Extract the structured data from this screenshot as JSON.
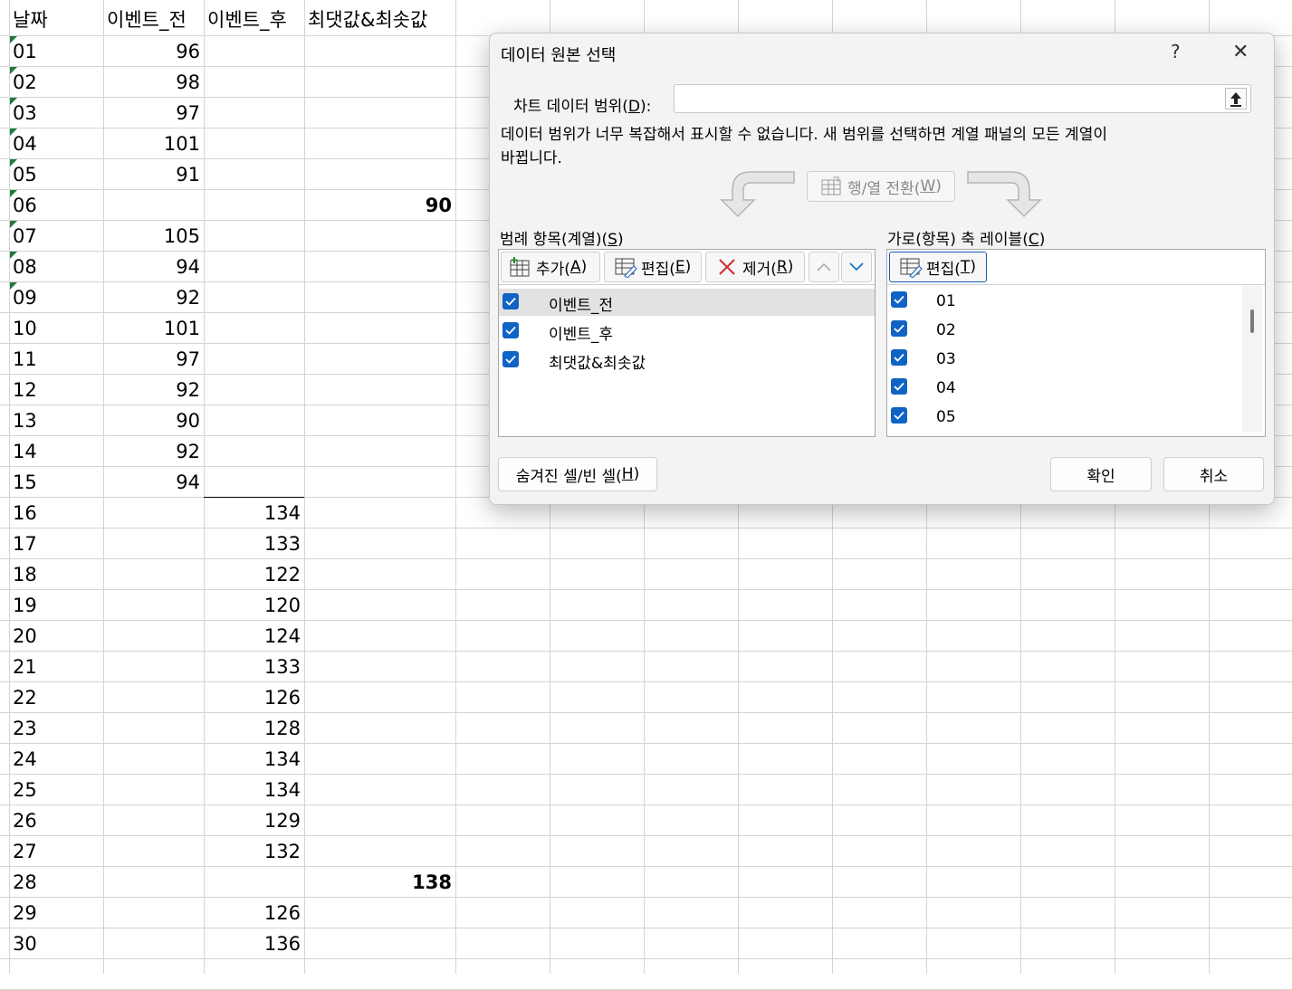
{
  "sheet": {
    "headers": [
      "날짜",
      "이벤트_전",
      "이벤트_후",
      "최댓값&최솟값"
    ],
    "rows": [
      [
        "01",
        "96",
        "",
        ""
      ],
      [
        "02",
        "98",
        "",
        ""
      ],
      [
        "03",
        "97",
        "",
        ""
      ],
      [
        "04",
        "101",
        "",
        ""
      ],
      [
        "05",
        "91",
        "",
        ""
      ],
      [
        "06",
        "",
        "",
        "90"
      ],
      [
        "07",
        "105",
        "",
        ""
      ],
      [
        "08",
        "94",
        "",
        ""
      ],
      [
        "09",
        "92",
        "",
        ""
      ],
      [
        "10",
        "101",
        "",
        ""
      ],
      [
        "11",
        "97",
        "",
        ""
      ],
      [
        "12",
        "92",
        "",
        ""
      ],
      [
        "13",
        "90",
        "",
        ""
      ],
      [
        "14",
        "92",
        "",
        ""
      ],
      [
        "15",
        "94",
        "",
        ""
      ],
      [
        "16",
        "",
        "134",
        ""
      ],
      [
        "17",
        "",
        "133",
        ""
      ],
      [
        "18",
        "",
        "122",
        ""
      ],
      [
        "19",
        "",
        "120",
        ""
      ],
      [
        "20",
        "",
        "124",
        ""
      ],
      [
        "21",
        "",
        "133",
        ""
      ],
      [
        "22",
        "",
        "126",
        ""
      ],
      [
        "23",
        "",
        "128",
        ""
      ],
      [
        "24",
        "",
        "134",
        ""
      ],
      [
        "25",
        "",
        "134",
        ""
      ],
      [
        "26",
        "",
        "129",
        ""
      ],
      [
        "27",
        "",
        "132",
        ""
      ],
      [
        "28",
        "",
        "",
        "138"
      ],
      [
        "29",
        "",
        "126",
        ""
      ],
      [
        "30",
        "",
        "136",
        ""
      ]
    ]
  },
  "dialog": {
    "title": "데이터 원본 선택",
    "help_icon": "?",
    "close_icon": "✕",
    "range_label": "차트 데이터 범위(",
    "range_key": "D",
    "range_label_end": "):",
    "range_value": "",
    "message_line1": "데이터 범위가 너무 복잡해서 표시할 수 없습니다. 새 범위를 선택하면 계열 패널의 모든 계열이",
    "message_line2": "바뀝니다.",
    "switch_button": "행/열 전환(",
    "switch_key": "W",
    "legend_header": "범례 항목(계열)(",
    "legend_key": "S",
    "axis_header": "가로(항목) 축 레이블(",
    "axis_key": "C",
    "add_button": "추가(",
    "add_key": "A",
    "edit_button": "편집(",
    "edit_key": "E",
    "remove_button": "제거(",
    "remove_key": "R",
    "axis_edit_button": "편집(",
    "axis_edit_key": "T",
    "series": [
      "이벤트_전",
      "이벤트_후",
      "최댓값&최솟값"
    ],
    "categories": [
      "01",
      "02",
      "03",
      "04",
      "05"
    ],
    "hidden_cells_button": "숨겨진 셀/빈 셀(",
    "hidden_cells_key": "H",
    "ok_button": "확인",
    "cancel_button": "취소",
    "colors": {
      "checkbox": "#0f63c4",
      "selected_row": "#e2e2e2",
      "remove_x": "#d13438"
    }
  }
}
